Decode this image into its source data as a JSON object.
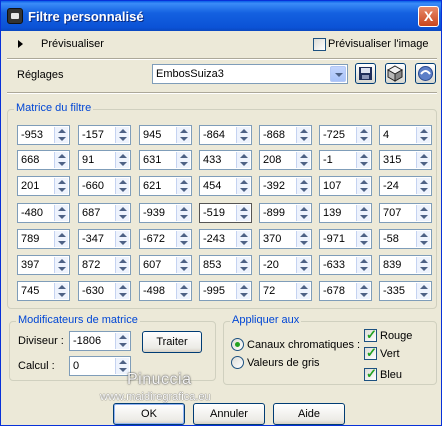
{
  "window": {
    "title": "Filtre personnalisé",
    "close_glyph": "X"
  },
  "preview": {
    "label": "Prévisualiser",
    "preview_image_label": "Prévisualiser l'image",
    "preview_image_checked": false
  },
  "reglages": {
    "label": "Réglages",
    "value": "EmbosSuiza3"
  },
  "icons": {
    "save": "save-icon",
    "cube": "cube-icon",
    "reset": "reset-icon"
  },
  "matrix": {
    "title": "Matrice du filtre",
    "rows": [
      [
        "-953",
        "-157",
        "945",
        "-864",
        "-868",
        "-725",
        "4"
      ],
      [
        "668",
        "91",
        "631",
        "433",
        "208",
        "-1",
        "315"
      ],
      [
        "201",
        "-660",
        "621",
        "454",
        "-392",
        "107",
        "-24"
      ],
      [
        "-480",
        "687",
        "-939",
        "-519",
        "-899",
        "139",
        "707"
      ],
      [
        "789",
        "-347",
        "-672",
        "-243",
        "370",
        "-971",
        "-58"
      ],
      [
        "397",
        "872",
        "607",
        "853",
        "-20",
        "-633",
        "839"
      ],
      [
        "745",
        "-630",
        "-498",
        "-995",
        "72",
        "-678",
        "-335"
      ]
    ]
  },
  "modifiers": {
    "title": "Modificateurs de matrice",
    "divisor_label": "Diviseur :",
    "divisor_value": "-1806",
    "bias_label": "Calcul :",
    "bias_value": "0",
    "treat_button": "Traiter"
  },
  "apply": {
    "title": "Appliquer aux",
    "chromatic_label": "Canaux chromatiques :",
    "gray_label": "Valeurs de gris",
    "red_label": "Rouge",
    "green_label": "Vert",
    "blue_label": "Bleu",
    "selected": "chromatic",
    "red_checked": true,
    "green_checked": true,
    "blue_checked": true
  },
  "buttons": {
    "ok": "OK",
    "cancel": "Annuler",
    "help": "Aide"
  },
  "watermark": {
    "line1": "Pinuccia",
    "line2": "www.maidiregrafica.eu"
  }
}
